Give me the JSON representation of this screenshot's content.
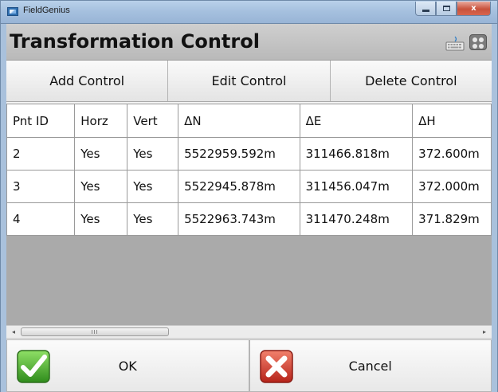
{
  "window": {
    "title": "FieldGenius",
    "close_glyph": "x"
  },
  "header": {
    "title": "Transformation Control",
    "icons": [
      "keyboard-icon",
      "dots-grid-icon"
    ]
  },
  "toolbar": {
    "add_label": "Add Control",
    "edit_label": "Edit Control",
    "delete_label": "Delete Control"
  },
  "table": {
    "columns": [
      "Pnt ID",
      "Horz",
      "Vert",
      "ΔN",
      "ΔE",
      "ΔH"
    ],
    "rows": [
      [
        "2",
        "Yes",
        "Yes",
        "5522959.592m",
        "311466.818m",
        "372.600m"
      ],
      [
        "3",
        "Yes",
        "Yes",
        "5522945.878m",
        "311456.047m",
        "372.000m"
      ],
      [
        "4",
        "Yes",
        "Yes",
        "5522963.743m",
        "311470.248m",
        "371.829m"
      ]
    ]
  },
  "scrollbar": {
    "left_arrow": "◂",
    "right_arrow": "▸",
    "grip": "III"
  },
  "footer": {
    "ok_label": "OK",
    "cancel_label": "Cancel"
  },
  "colors": {
    "ok_green": "#4caf2a",
    "cancel_red": "#d83a2a",
    "table_bg": "#aaaaaa"
  }
}
